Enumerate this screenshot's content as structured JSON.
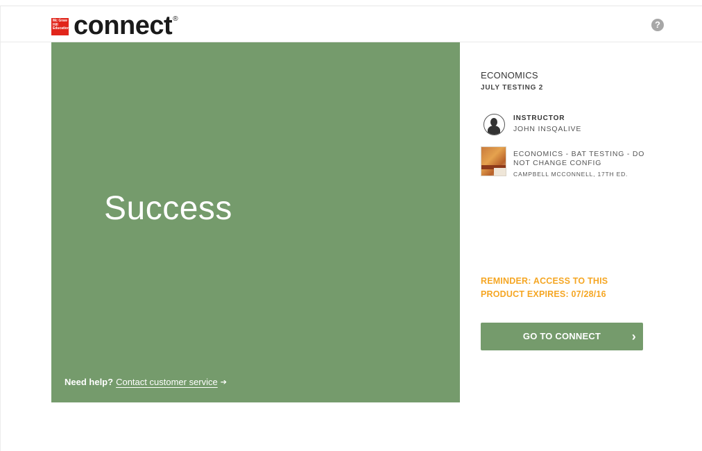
{
  "header": {
    "logo_text": "Mc Graw Hill Education",
    "wordmark": "connect",
    "registered": "®",
    "help_glyph": "?"
  },
  "success_panel": {
    "title": "Success",
    "help_question": "Need help?",
    "help_link": "Contact customer service",
    "help_arrow": "➔"
  },
  "course": {
    "title": "ECONOMICS",
    "subtitle": "JULY TESTING 2"
  },
  "instructor": {
    "label": "INSTRUCTOR",
    "name": "JOHN INSQALIVE"
  },
  "book": {
    "title": "ECONOMICS - BAT TESTING - DO NOT CHANGE CONFIG",
    "author": "CAMPBELL MCCONNELL, 17TH ED."
  },
  "reminder": {
    "text": "REMINDER: ACCESS TO THIS PRODUCT EXPIRES: 07/28/16"
  },
  "go_button": {
    "label": "GO TO CONNECT",
    "chevron": "›"
  },
  "colors": {
    "accent_green": "#759b6c",
    "reminder_orange": "#f5a623",
    "brand_red": "#e1251b"
  },
  "icons": [
    "help-icon",
    "instructor-avatar-icon",
    "book-cover-icon",
    "chevron-right-icon",
    "arrow-right-icon"
  ]
}
